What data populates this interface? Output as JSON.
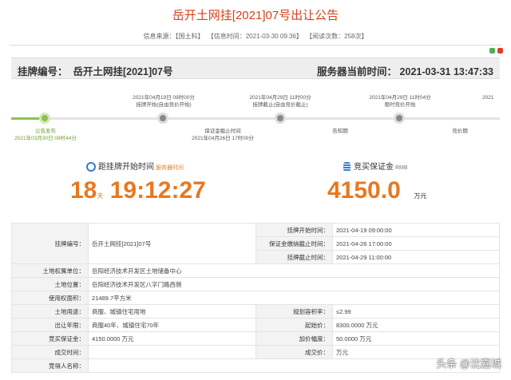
{
  "page": {
    "title": "岳开土网挂[2021]07号出让公告",
    "meta": {
      "source": "信息来源：【国土科】",
      "time": "【信息时间：2021-03-30 09:36】",
      "reads": "【阅读次数：258次】"
    }
  },
  "header_bar": {
    "listing_no_label": "挂牌编号：",
    "listing_no": "岳开土网挂[2021]07号",
    "server_time_label": "服务器当前时间：",
    "server_time": "2021-03-31 13:47:33"
  },
  "timeline": {
    "progress": 0.06,
    "top": [
      {
        "date": "2021年04月19日 09时00分",
        "name": "挂牌开始(自由竞价开始)"
      },
      {
        "date": "2021年04月29日 11时00分",
        "name": "挂牌截止(自由竞价截止)"
      },
      {
        "date": "2021年04月29日 11时04分",
        "name": "限时竞价开始"
      },
      {
        "date": "2021"
      }
    ],
    "bottom": [
      {
        "name": "公告发布",
        "date": "2021年03月30日 09时44分"
      },
      {
        "name": "保证金截止时间",
        "date": "2021年04月26日 17时00分"
      },
      {
        "name": "告知期"
      },
      {
        "name": "竞价期"
      }
    ]
  },
  "countdown": {
    "label": "距挂牌开始时间",
    "note": "服务器时间",
    "days": "18",
    "days_unit": "天",
    "time": "19:12:27"
  },
  "deposit": {
    "label": "竞买保证金",
    "unit_note": "RMB",
    "value": "4150.0",
    "unit": "万元"
  },
  "details": {
    "listing_no_k": "挂牌编号：",
    "listing_no_v": "岳开土网挂[2021]07号",
    "start_k": "挂牌开始时间：",
    "start_v": "2021-04-19 09:00:00",
    "deposit_deadline_k": "保证金缴纳截止时间：",
    "deposit_deadline_v": "2021-04-26 17:00:00",
    "end_k": "挂牌截止时间：",
    "end_v": "2021-04-29 11:00:00",
    "owner_k": "土地权属单位：",
    "owner_v": "岳阳经济技术开发区土地储备中心",
    "location_k": "土地位置：",
    "location_v": "岳阳经济技术开发区八字门路西侧",
    "area_k": "使用权面积：",
    "area_v": "21489.7平方米",
    "usage_k": "土地用途：",
    "usage_v": "商服、城镇住宅用地",
    "far_k": "规划容积率：",
    "far_v": "≤2.99",
    "term_k": "出让年限：",
    "term_v": "商服40年、城镇住宅70年",
    "start_price_k": "起始价：",
    "start_price_v": "8300.0000 万元",
    "deposit_k": "竞买保证金：",
    "deposit_v": "4150.0000 万元",
    "increment_k": "加价幅度：",
    "increment_v": "50.0000 万元",
    "deal_time_k": "成交时间：",
    "deal_time_v": "",
    "deal_price_k": "成交价：",
    "deal_price_v": "万元",
    "bidder_k": "竞得人名称：",
    "bidder_v": ""
  },
  "watermark": "头条 @沈嘉城",
  "colors": {
    "accent": "#d9401b",
    "orange": "#e8781f",
    "green": "#8bc34a",
    "blue": "#2d7fd3"
  }
}
